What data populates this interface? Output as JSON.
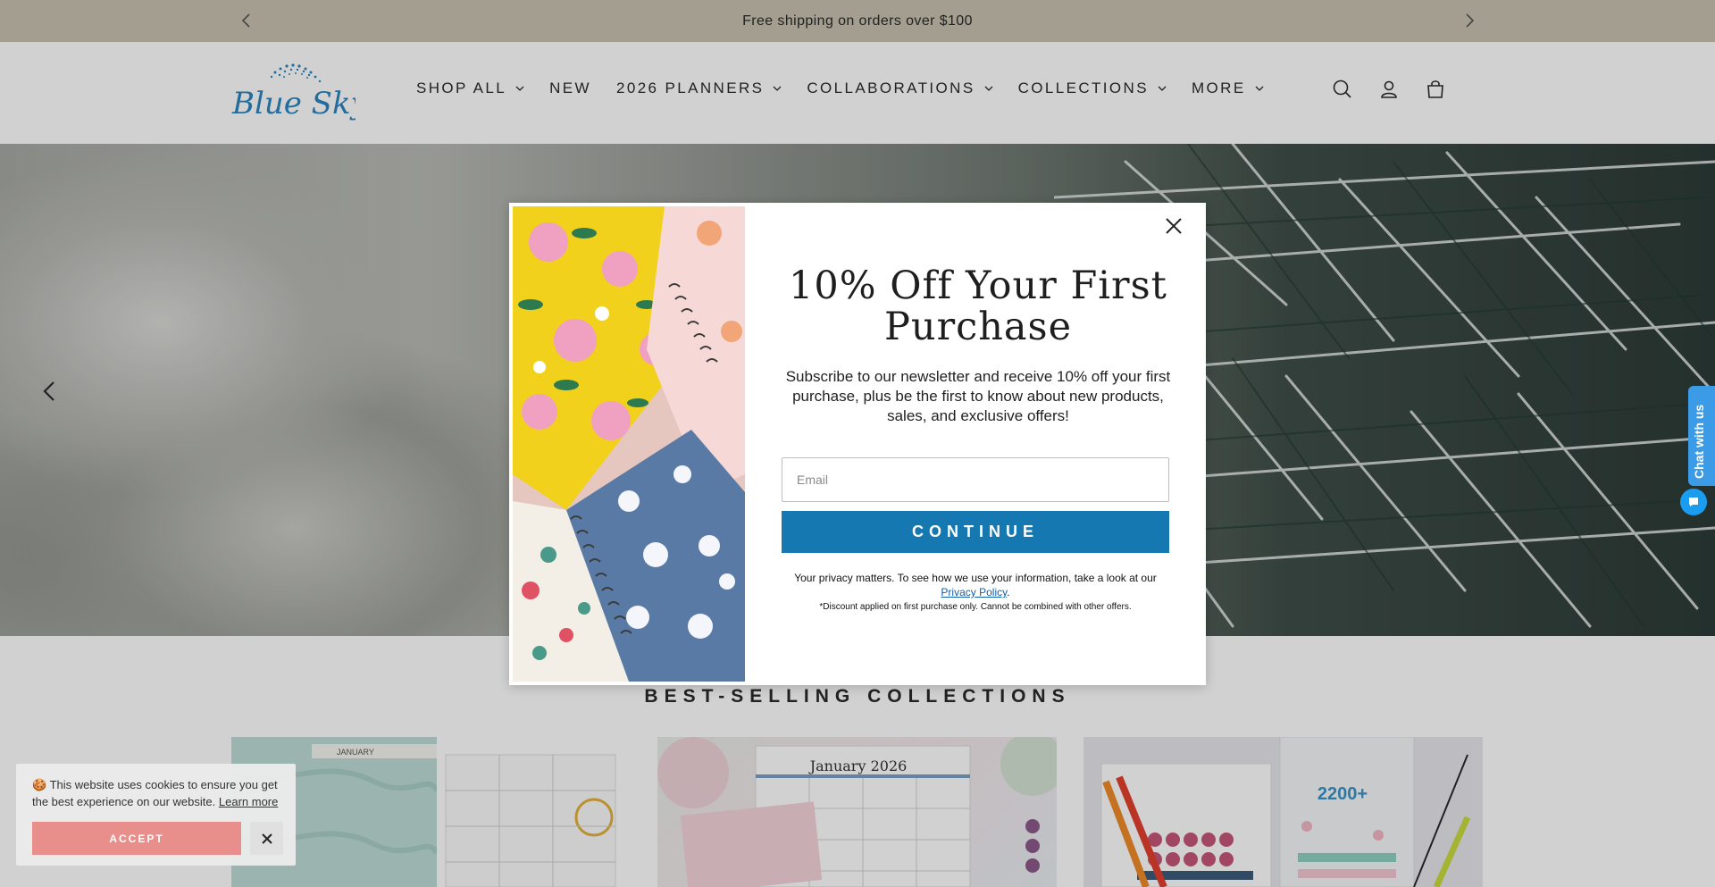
{
  "announcement": {
    "text": "Free shipping on orders over $100",
    "prev_icon": "chevron-left-icon",
    "next_icon": "chevron-right-icon"
  },
  "header": {
    "logo_text": "Blue Sky",
    "nav": [
      {
        "label": "SHOP ALL",
        "has_dropdown": true
      },
      {
        "label": "NEW",
        "has_dropdown": false
      },
      {
        "label": "2026 PLANNERS",
        "has_dropdown": true
      },
      {
        "label": "COLLABORATIONS",
        "has_dropdown": true
      },
      {
        "label": "COLLECTIONS",
        "has_dropdown": true
      },
      {
        "label": "MORE",
        "has_dropdown": true
      }
    ],
    "icons": [
      "search-icon",
      "account-icon",
      "cart-icon"
    ]
  },
  "hero": {
    "prev_icon": "chevron-left-icon"
  },
  "best_selling": {
    "title": "BEST-SELLING COLLECTIONS",
    "cards": [
      {
        "image_text": "JANUARY"
      },
      {
        "image_text": "January 2026"
      },
      {
        "image_text": "2200+"
      }
    ]
  },
  "modal": {
    "title": "10% Off Your First Purchase",
    "subtitle": "Subscribe to our newsletter and receive 10% off your first purchase, plus be the first to know about new products, sales, and exclusive offers!",
    "email_placeholder": "Email",
    "email_value": "",
    "continue_label": "CONTINUE",
    "privacy_text": "Your privacy matters. To see how we use your information, take a look at our",
    "privacy_link": "Privacy Policy",
    "privacy_end": ".",
    "disclaimer": "*Discount applied on first purchase only. Cannot be combined with other offers.",
    "close_icon": "close-icon"
  },
  "chat": {
    "label": "Chat with us"
  },
  "cookie": {
    "emoji": "🍪",
    "text": "This website uses cookies to ensure you get the best experience on our website.",
    "learn_more": "Learn more",
    "accept_label": "ACCEPT"
  },
  "colors": {
    "announcement_bg": "#c9c1b0",
    "brand_blue": "#1578b0",
    "accept_bg": "#e88f8c",
    "chat_blue": "#3b9be6"
  }
}
